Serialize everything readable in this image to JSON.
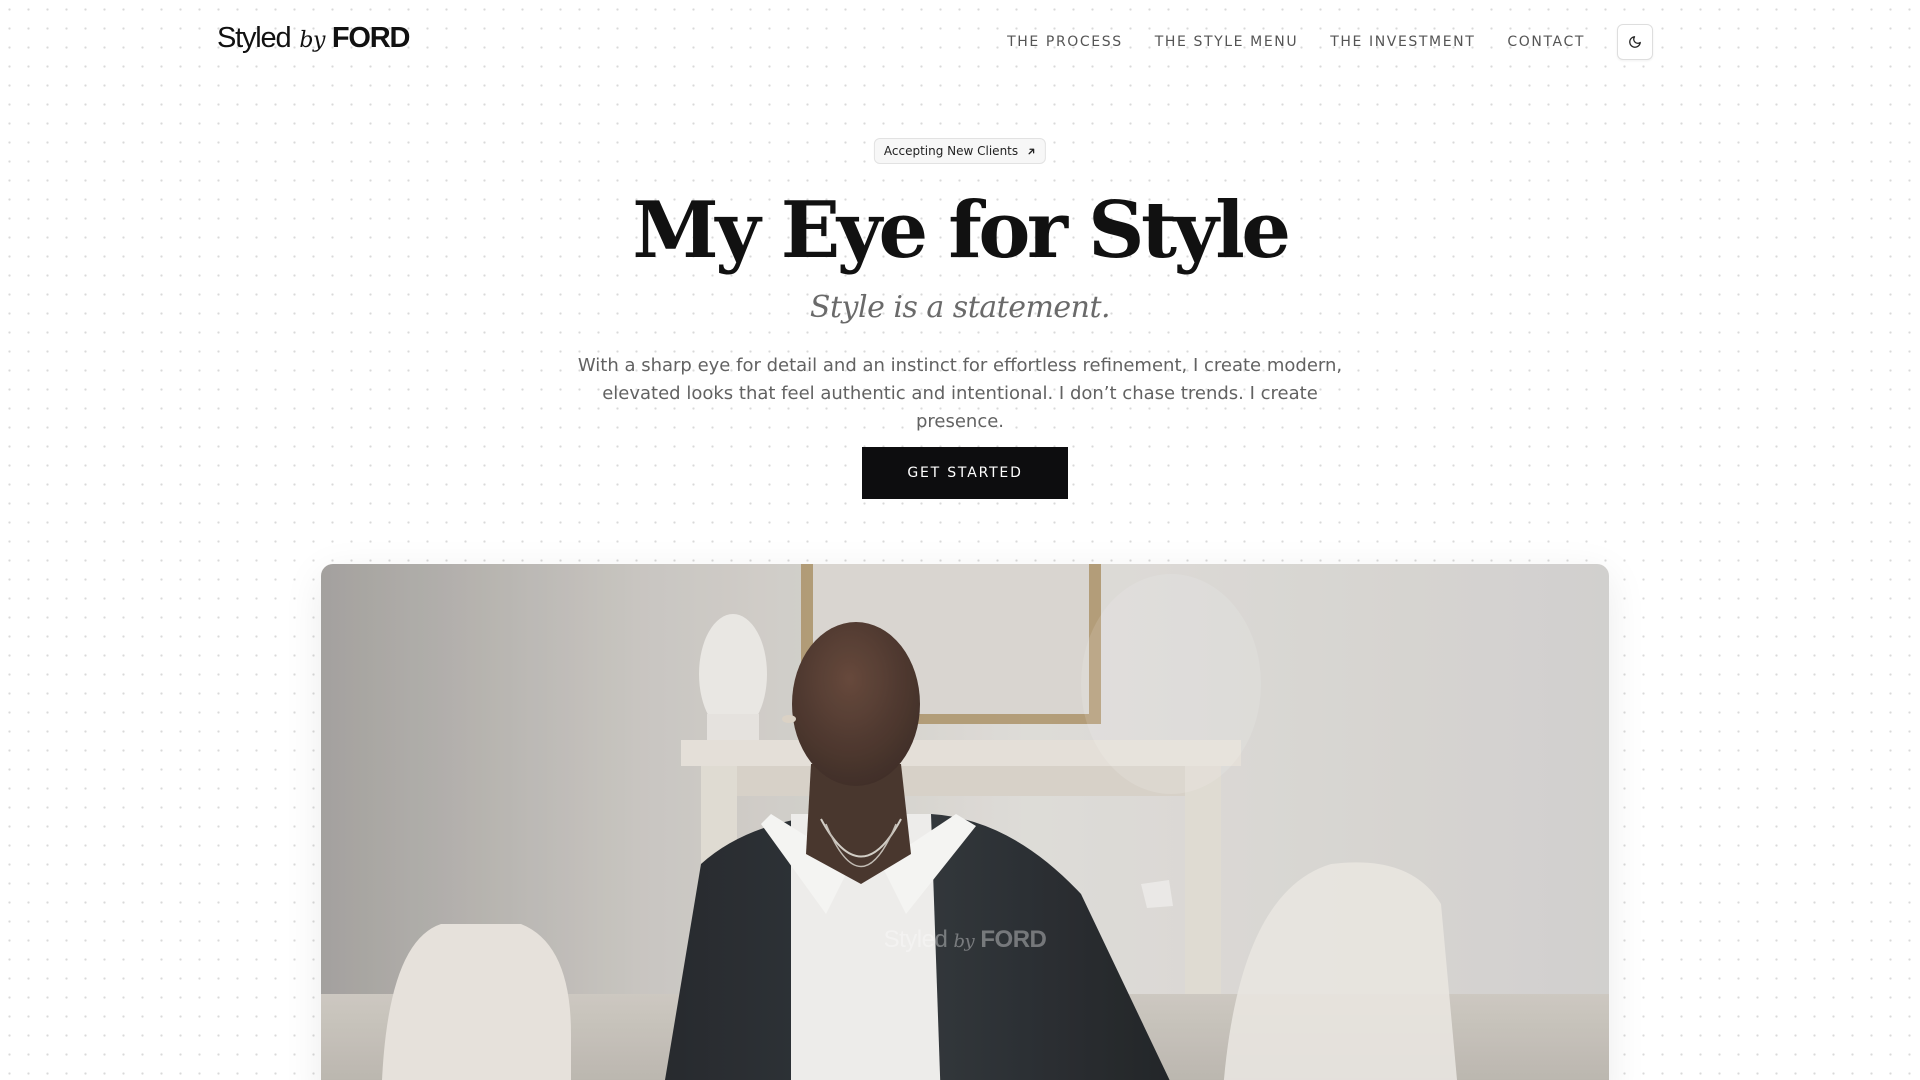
{
  "header": {
    "logo": {
      "styled": "Styled",
      "by": "by",
      "ford": "FORD"
    },
    "nav": [
      {
        "label": "THE PROCESS"
      },
      {
        "label": "THE STYLE MENU"
      },
      {
        "label": "THE INVESTMENT"
      },
      {
        "label": "CONTACT"
      }
    ],
    "theme_toggle_icon": "moon-icon"
  },
  "hero": {
    "badge": {
      "label": "Accepting New Clients",
      "icon": "arrow-up-right-icon"
    },
    "title": "My Eye for Style",
    "subtitle": "Style is a statement.",
    "description_line1": "With a sharp eye for detail and an instinct for effortless refinement, I create modern,",
    "description_line2": "elevated looks that feel authentic and intentional. I don’t chase trends. I create presence.",
    "cta_label": "GET STARTED"
  },
  "video": {
    "watermark_logo": {
      "styled": "Styled",
      "by": "by",
      "ford": "FORD"
    }
  },
  "colors": {
    "accent": "#0d0d0f",
    "background": "#ffffff",
    "muted_text": "#626262"
  }
}
